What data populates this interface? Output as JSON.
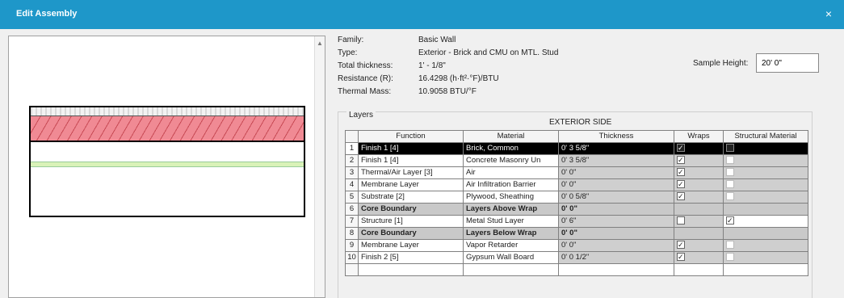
{
  "window": {
    "title": "Edit Assembly",
    "close_glyph": "×"
  },
  "info": {
    "rows": [
      {
        "label": "Family:",
        "value": "Basic Wall"
      },
      {
        "label": "Type:",
        "value": "Exterior - Brick and CMU on MTL. Stud"
      },
      {
        "label": "Total thickness:",
        "value": "1' - 1/8\""
      },
      {
        "label": "Resistance (R):",
        "value": "16.4298 (h·ft²·°F)/BTU"
      },
      {
        "label": "Thermal Mass:",
        "value": "10.9058 BTU/°F"
      }
    ],
    "sample_height_label": "Sample Height:",
    "sample_height_value": "20' 0\""
  },
  "layers": {
    "group_label": "Layers",
    "side_label": "EXTERIOR SIDE",
    "columns": [
      "",
      "Function",
      "Material",
      "Thickness",
      "Wraps",
      "Structural Material"
    ],
    "rows": [
      {
        "num": "1",
        "function": "Finish 1 [4]",
        "material": "Brick, Common",
        "thickness": "0' 3 5/8\"",
        "wraps": true,
        "structural": false,
        "style": "sel"
      },
      {
        "num": "2",
        "function": "Finish 1 [4]",
        "material": "Concrete Masonry Un",
        "thickness": "0' 3 5/8\"",
        "wraps": true,
        "structural": false,
        "style": ""
      },
      {
        "num": "3",
        "function": "Thermal/Air Layer [3]",
        "material": "Air",
        "thickness": "0' 0\"",
        "wraps": true,
        "structural": false,
        "style": ""
      },
      {
        "num": "4",
        "function": "Membrane Layer",
        "material": "Air Infiltration Barrier",
        "thickness": "0' 0\"",
        "wraps": true,
        "structural": false,
        "style": ""
      },
      {
        "num": "5",
        "function": "Substrate [2]",
        "material": "Plywood, Sheathing",
        "thickness": "0' 0 5/8\"",
        "wraps": true,
        "structural": false,
        "style": ""
      },
      {
        "num": "6",
        "function": "Core Boundary",
        "material": "Layers Above Wrap",
        "thickness": "0' 0\"",
        "wraps": null,
        "structural": null,
        "style": "core"
      },
      {
        "num": "7",
        "function": "Structure [1]",
        "material": "Metal Stud Layer",
        "thickness": "0' 6\"",
        "wraps": false,
        "structural": true,
        "style": ""
      },
      {
        "num": "8",
        "function": "Core Boundary",
        "material": "Layers Below Wrap",
        "thickness": "0' 0\"",
        "wraps": null,
        "structural": null,
        "style": "core"
      },
      {
        "num": "9",
        "function": "Membrane Layer",
        "material": "Vapor Retarder",
        "thickness": "0' 0\"",
        "wraps": true,
        "structural": false,
        "style": ""
      },
      {
        "num": "10",
        "function": "Finish 2 [5]",
        "material": "Gypsum Wall Board",
        "thickness": "0' 0 1/2\"",
        "wraps": true,
        "structural": false,
        "style": ""
      }
    ]
  },
  "colors": {
    "titlebar": "#1e97c9",
    "hatch_fill": "#f08a94",
    "membrane": "#d9f2b8"
  }
}
